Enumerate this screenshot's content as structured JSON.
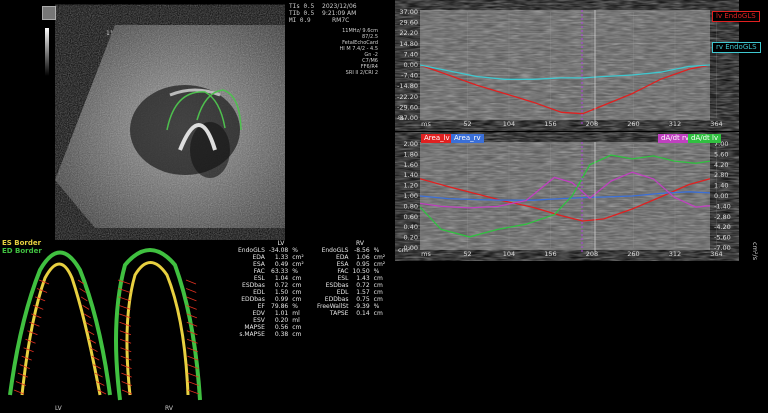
{
  "top_left": {
    "tis": "TIs  0.5",
    "tib": "TIb  0.5",
    "mi": "MI  0.9"
  },
  "header_info": [
    "2023/12/06",
    "9:21:09 AM",
    "RM7C"
  ],
  "probe": "11",
  "acq_params": [
    "11MHz/ 9.6cm",
    "87/2.5",
    "FetalEchoCard",
    "HI M 7.4/2 - 4.5",
    "Gn -2",
    "C7/M6",
    "FF6/R4",
    "SRI II 2/CRI 2"
  ],
  "chart_top": {
    "ylabel": "%",
    "yticks": [
      "37.00",
      "29.60",
      "22.20",
      "14.80",
      "7.40",
      "0.00",
      "-7.40",
      "-14.80",
      "-22.20",
      "-29.60",
      "-37.00"
    ],
    "xticks": [
      "ms",
      "52",
      "104",
      "156",
      "208",
      "260",
      "312",
      "364"
    ],
    "legend_lv": "lv EndoGLS",
    "legend_rv": "rv EndoGLS",
    "color_lv": "#e02020",
    "color_rv": "#3fc8d0"
  },
  "chart_bottom": {
    "ylabel_left": "cm²",
    "ylabel_right": "cm²/s",
    "yticks_left": [
      "2.00",
      "1.80",
      "1.60",
      "1.40",
      "1.20",
      "1.00",
      "0.80",
      "0.60",
      "0.40",
      "0.20",
      "0.00"
    ],
    "yticks_right": [
      "7.00",
      "5.60",
      "4.20",
      "2.80",
      "1.40",
      "0.00",
      "-1.40",
      "-2.80",
      "-4.20",
      "-5.60",
      "-7.00"
    ],
    "xticks": [
      "ms",
      "52",
      "104",
      "156",
      "208",
      "260",
      "312",
      "364"
    ],
    "legend_area_lv": "Area_lv",
    "legend_area_rv": "Area_rv",
    "legend_da_rv": "dA/dt rv",
    "legend_da_lv": "dA/dt lv",
    "color_area_lv": "#e02020",
    "color_area_rv": "#3a6fd8",
    "color_da_rv": "#c040c0",
    "color_da_lv": "#30c040"
  },
  "chart_data": [
    {
      "type": "line",
      "xlabel": "ms",
      "ylabel": "%",
      "xlim": [
        0,
        410
      ],
      "ylim": [
        -37,
        37
      ],
      "series": [
        {
          "name": "lv EndoGLS",
          "x": [
            0,
            40,
            80,
            120,
            160,
            200,
            230,
            260,
            300,
            340,
            380,
            410
          ],
          "y": [
            0,
            -7,
            -14,
            -20,
            -26,
            -33,
            -34,
            -28,
            -20,
            -10,
            -3,
            0
          ]
        },
        {
          "name": "rv EndoGLS",
          "x": [
            0,
            40,
            80,
            120,
            160,
            200,
            230,
            260,
            300,
            340,
            380,
            410
          ],
          "y": [
            0,
            -4,
            -8,
            -10,
            -10,
            -9,
            -9,
            -8,
            -7,
            -5,
            -1,
            0
          ]
        }
      ]
    },
    {
      "type": "line",
      "xlabel": "ms",
      "ylim_left": [
        0,
        2
      ],
      "ylim_right": [
        -7,
        7
      ],
      "xlim": [
        0,
        410
      ],
      "series": [
        {
          "name": "Area_lv",
          "axis": "left",
          "x": [
            0,
            40,
            80,
            120,
            160,
            200,
            230,
            260,
            300,
            340,
            380,
            410
          ],
          "y": [
            1.33,
            1.18,
            1.04,
            0.9,
            0.78,
            0.62,
            0.52,
            0.56,
            0.75,
            0.98,
            1.22,
            1.33
          ]
        },
        {
          "name": "Area_rv",
          "axis": "left",
          "x": [
            0,
            40,
            80,
            120,
            160,
            200,
            230,
            260,
            300,
            340,
            380,
            410
          ],
          "y": [
            1.0,
            0.95,
            0.93,
            0.92,
            0.92,
            0.95,
            0.97,
            0.98,
            1.0,
            1.05,
            1.08,
            1.06
          ]
        },
        {
          "name": "dA/dt rv",
          "axis": "right",
          "x": [
            0,
            30,
            70,
            110,
            150,
            190,
            215,
            240,
            270,
            300,
            330,
            360,
            390,
            410
          ],
          "y": [
            -1.0,
            -1.4,
            -1.6,
            -1.4,
            -0.6,
            2.5,
            1.8,
            -0.3,
            2.0,
            3.2,
            2.3,
            -0.2,
            -1.5,
            -1.3
          ]
        },
        {
          "name": "dA/dt lv",
          "axis": "right",
          "x": [
            0,
            30,
            70,
            110,
            150,
            190,
            215,
            240,
            270,
            300,
            330,
            360,
            390,
            410
          ],
          "y": [
            -1.5,
            -4.5,
            -5.5,
            -4.5,
            -3.8,
            -2.5,
            0,
            4.2,
            5.5,
            5.0,
            5.4,
            4.7,
            4.4,
            4.7
          ]
        }
      ]
    }
  ],
  "border_legend": {
    "es": "ES Border",
    "ed": "ED Border",
    "es_color": "#e8d040",
    "ed_color": "#40c040"
  },
  "chamber_labels": {
    "lv": "LV",
    "rv": "RV"
  },
  "lv_table": {
    "title": "LV",
    "rows": [
      {
        "label": "EndoGLS",
        "value": "-34.08",
        "unit": "%"
      },
      {
        "label": "EDA",
        "value": "1.33",
        "unit": "cm²"
      },
      {
        "label": "ESA",
        "value": "0.49",
        "unit": "cm²"
      },
      {
        "label": "FAC",
        "value": "63.33",
        "unit": "%"
      },
      {
        "label": "ESL",
        "value": "1.04",
        "unit": "cm"
      },
      {
        "label": "ESDbas",
        "value": "0.72",
        "unit": "cm"
      },
      {
        "label": "EDL",
        "value": "1.50",
        "unit": "cm"
      },
      {
        "label": "EDDbas",
        "value": "0.99",
        "unit": "cm"
      },
      {
        "label": "EF",
        "value": "79.86",
        "unit": "%"
      },
      {
        "label": "EDV",
        "value": "1.01",
        "unit": "ml"
      },
      {
        "label": "ESV",
        "value": "0.20",
        "unit": "ml"
      },
      {
        "label": "MAPSE",
        "value": "0.56",
        "unit": "cm"
      },
      {
        "label": "s.MAPSE",
        "value": "0.38",
        "unit": "cm"
      }
    ]
  },
  "rv_table": {
    "title": "RV",
    "rows": [
      {
        "label": "EndoGLS",
        "value": "-8.56",
        "unit": "%"
      },
      {
        "label": "EDA",
        "value": "1.06",
        "unit": "cm²"
      },
      {
        "label": "ESA",
        "value": "0.95",
        "unit": "cm²"
      },
      {
        "label": "FAC",
        "value": "10.50",
        "unit": "%"
      },
      {
        "label": "ESL",
        "value": "1.43",
        "unit": "cm"
      },
      {
        "label": "ESDbas",
        "value": "0.72",
        "unit": "cm"
      },
      {
        "label": "EDL",
        "value": "1.57",
        "unit": "cm"
      },
      {
        "label": "EDDbas",
        "value": "0.75",
        "unit": "cm"
      },
      {
        "label": "FreeWallSt",
        "value": "-9.39",
        "unit": "%"
      },
      {
        "label": "TAPSE",
        "value": "0.14",
        "unit": "cm"
      }
    ]
  }
}
